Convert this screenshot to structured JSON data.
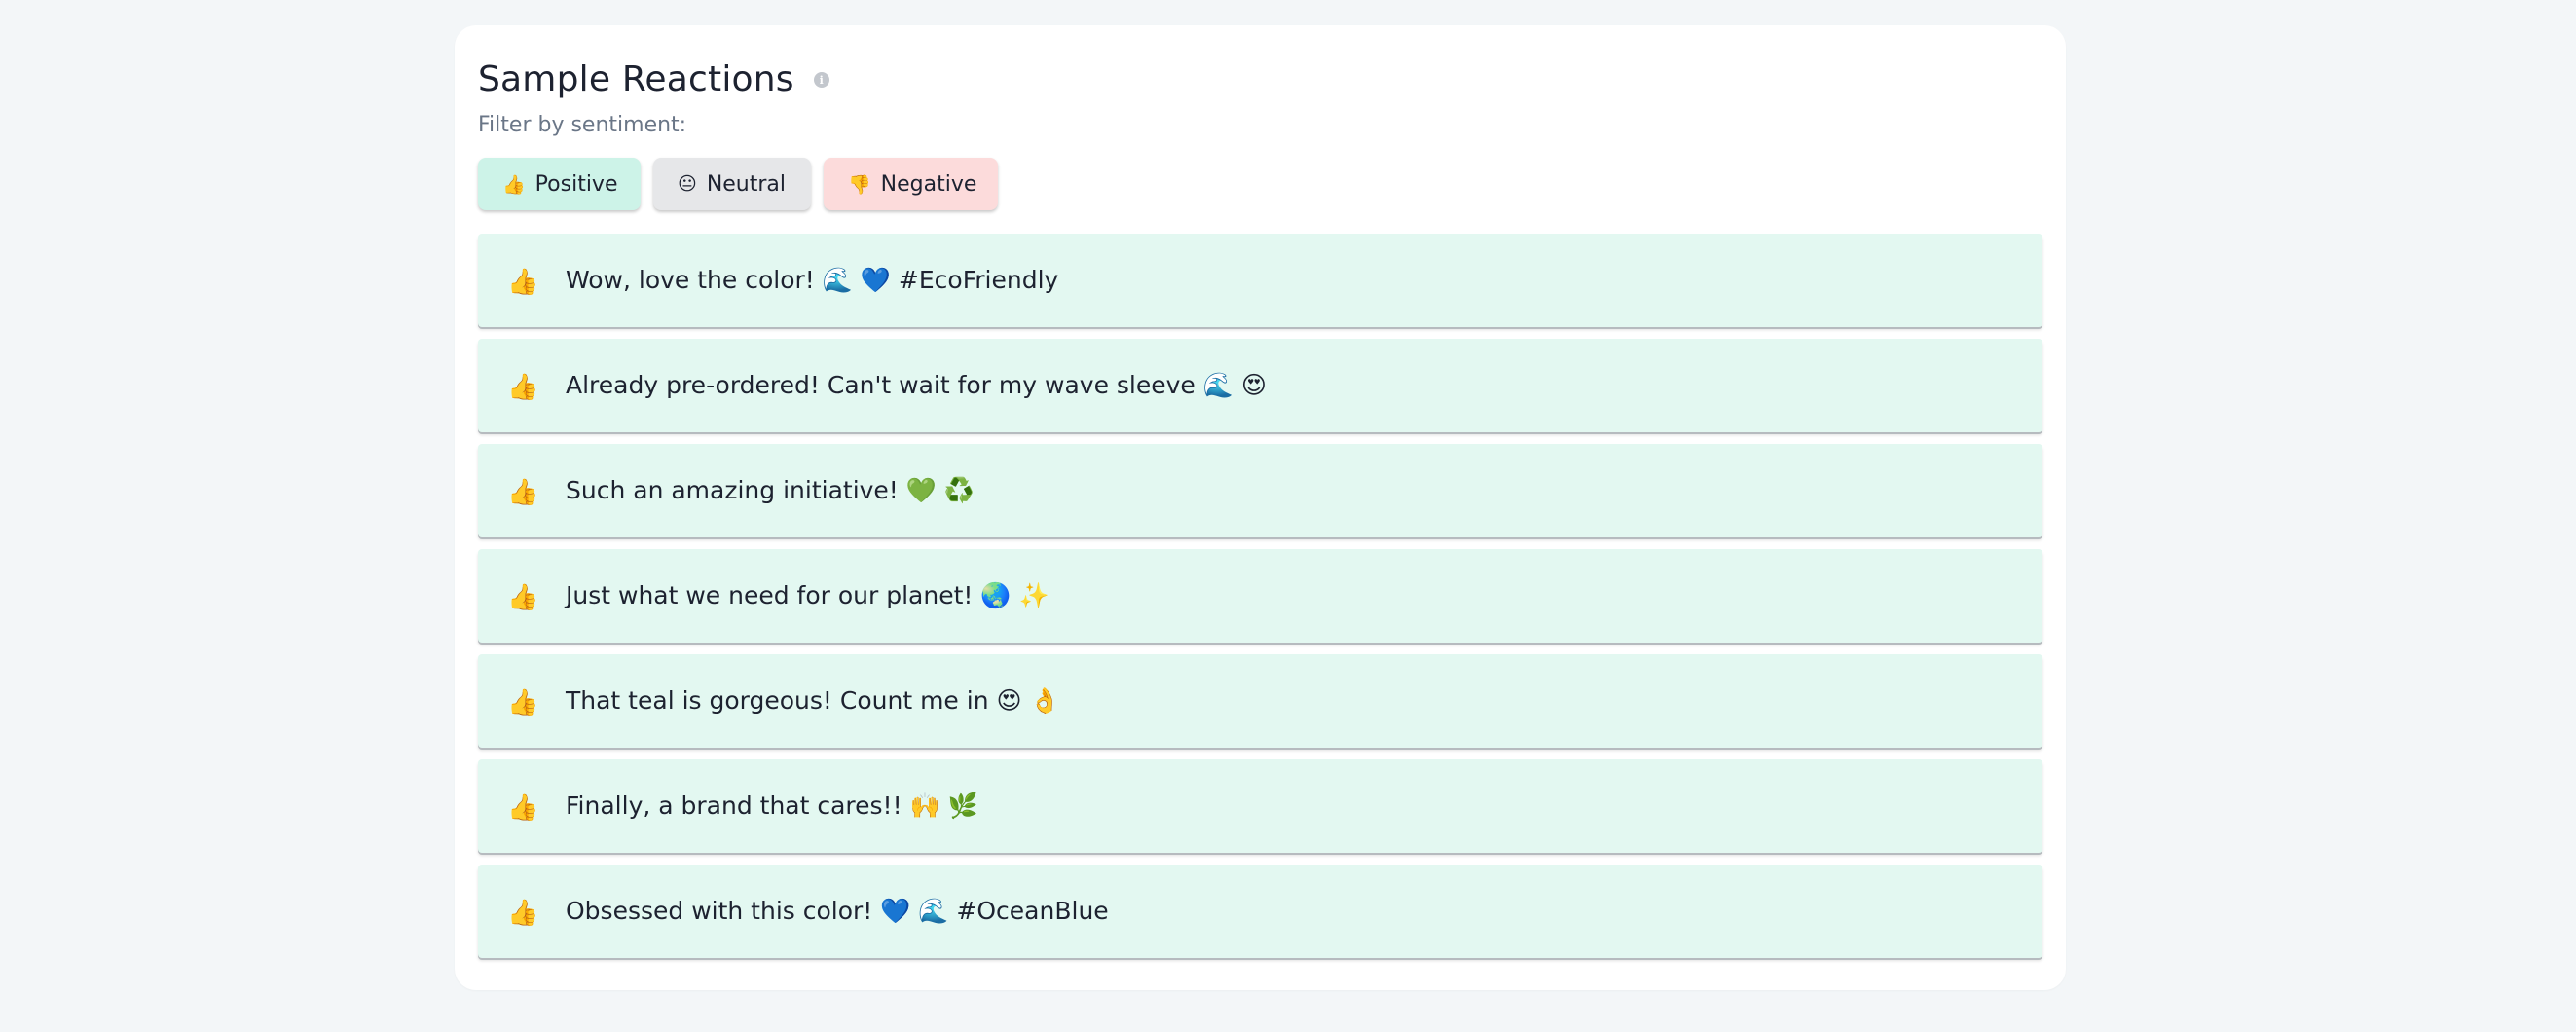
{
  "header": {
    "title": "Sample Reactions",
    "info_icon": "info-icon",
    "info_glyph": "i"
  },
  "filter": {
    "label": "Filter by sentiment:",
    "buttons": [
      {
        "emoji": "👍",
        "label": "Positive",
        "color": "#cdf3e8"
      },
      {
        "emoji": "😐",
        "label": "Neutral",
        "color": "#e6e7e9"
      },
      {
        "emoji": "👎",
        "label": "Negative",
        "color": "#fcdbdb"
      }
    ]
  },
  "reactions": [
    {
      "icon": "👍",
      "text": "Wow, love the color! 🌊 💙 #EcoFriendly"
    },
    {
      "icon": "👍",
      "text": "Already pre-ordered! Can't wait for my wave sleeve 🌊 😍"
    },
    {
      "icon": "👍",
      "text": "Such an amazing initiative! 💚 ♻️"
    },
    {
      "icon": "👍",
      "text": "Just what we need for our planet! 🌏 ✨"
    },
    {
      "icon": "👍",
      "text": "That teal is gorgeous! Count me in 😍 👌"
    },
    {
      "icon": "👍",
      "text": "Finally, a brand that cares!! 🙌 🌿"
    },
    {
      "icon": "👍",
      "text": "Obsessed with this color! 💙 🌊 #OceanBlue"
    }
  ],
  "colors": {
    "background": "#f3f6f8",
    "card": "#ffffff",
    "positive_row": "#e3f8f1"
  }
}
